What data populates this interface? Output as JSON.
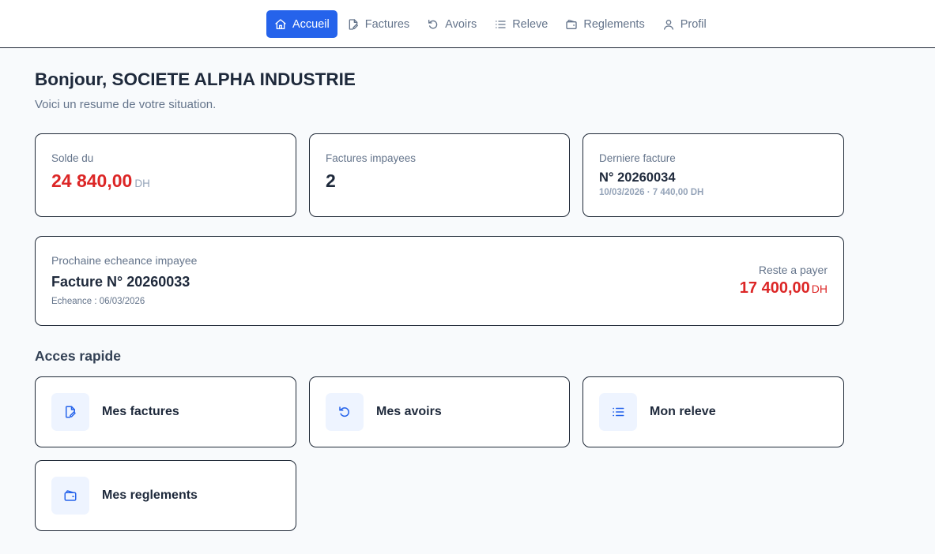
{
  "nav": {
    "items": [
      {
        "label": "Accueil",
        "icon": "home-icon",
        "active": true
      },
      {
        "label": "Factures",
        "icon": "invoice-icon",
        "active": false
      },
      {
        "label": "Avoirs",
        "icon": "undo-icon",
        "active": false
      },
      {
        "label": "Releve",
        "icon": "list-icon",
        "active": false
      },
      {
        "label": "Reglements",
        "icon": "wallet-icon",
        "active": false
      },
      {
        "label": "Profil",
        "icon": "user-icon",
        "active": false
      }
    ]
  },
  "header": {
    "greeting": "Bonjour, SOCIETE ALPHA INDUSTRIE",
    "subtitle": "Voici un resume de votre situation."
  },
  "stats": {
    "balance": {
      "label": "Solde du",
      "amount": "24 840,00",
      "unit": "DH"
    },
    "unpaid": {
      "label": "Factures impayees",
      "count": "2"
    },
    "last_invoice": {
      "label": "Derniere facture",
      "number": "N° 20260034",
      "meta": "10/03/2026 · 7 440,00 DH"
    }
  },
  "next_due": {
    "label": "Prochaine echeance impayee",
    "title": "Facture N° 20260033",
    "due_date": "Echeance : 06/03/2026",
    "remaining_label": "Reste a payer",
    "remaining_amount": "17 400,00",
    "remaining_unit": "DH"
  },
  "quick_access": {
    "title": "Acces rapide",
    "items": [
      {
        "label": "Mes factures",
        "icon": "invoice-icon"
      },
      {
        "label": "Mes avoirs",
        "icon": "undo-icon"
      },
      {
        "label": "Mon releve",
        "icon": "list-icon"
      },
      {
        "label": "Mes reglements",
        "icon": "wallet-icon"
      }
    ]
  },
  "colors": {
    "accent": "#2563eb",
    "danger": "#dc2626",
    "muted": "#64748b",
    "icon_bg": "#eef4ff"
  }
}
